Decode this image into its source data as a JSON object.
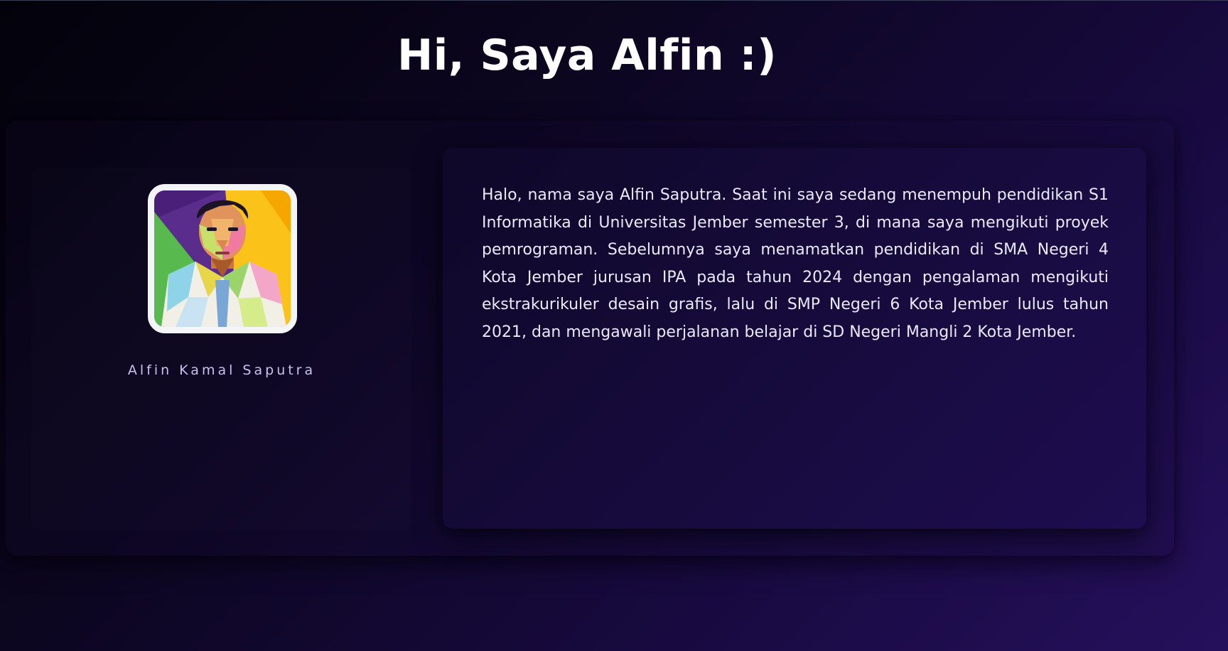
{
  "header": {
    "title": "Hi, Saya Alfin :)"
  },
  "profile": {
    "avatar_icon": "portrait-illustration",
    "name": "Alfin Kamal Saputra"
  },
  "about": {
    "text": "Halo, nama saya Alfin Saputra. Saat ini saya sedang menempuh pendidikan S1 Informatika di Universitas Jember semester 3, di mana saya mengikuti proyek pemrograman. Sebelumnya saya menamatkan pendidikan di SMA Negeri 4 Kota Jember jurusan IPA pada tahun 2024 dengan pengalaman mengikuti ekstrakurikuler desain grafis, lalu di SMP Negeri 6 Kota Jember lulus tahun 2021, dan mengawali perjalanan belajar di SD Negeri Mangli 2 Kota Jember."
  },
  "colors": {
    "background_start": "#03020a",
    "background_end": "#25105c",
    "card": "#170b3e",
    "name_text": "#c8c2ee",
    "avatar_border": "#f4f5f8"
  }
}
